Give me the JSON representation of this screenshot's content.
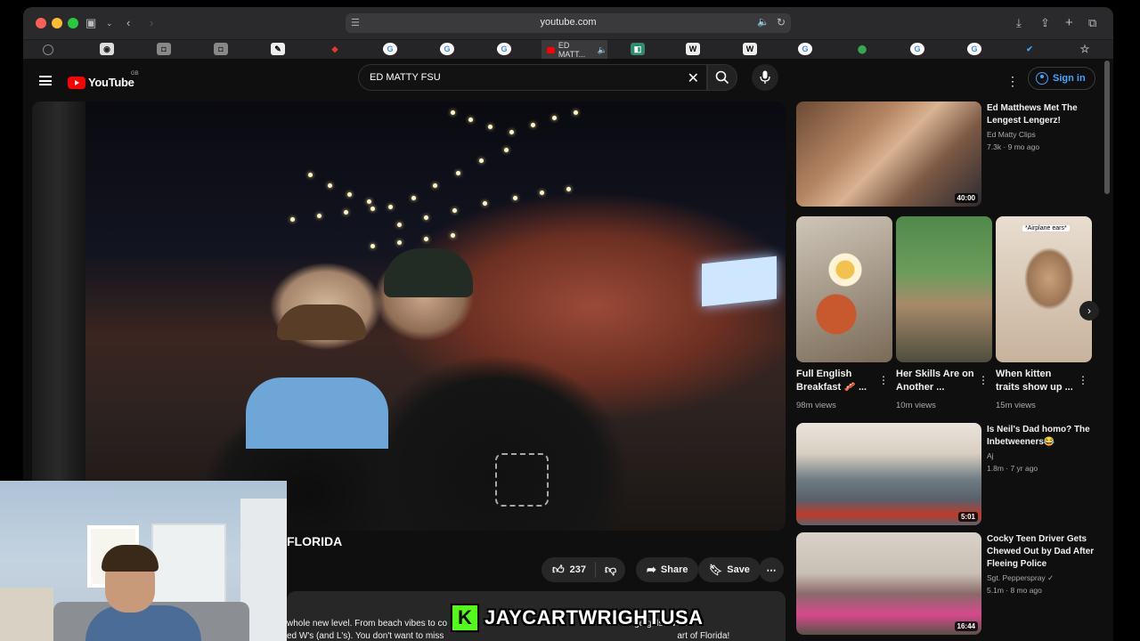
{
  "browser": {
    "url": "youtube.com",
    "active_tab_label": "ED MATT..."
  },
  "header": {
    "logo_text": "YouTube",
    "logo_region": "GB",
    "search_value": "ED MATTY FSU",
    "sign_in": "Sign in"
  },
  "video": {
    "title_visible": "FLORIDA",
    "likes": "237",
    "share_label": "Share",
    "save_label": "Save",
    "description_line1": "whole new level. From beach vibes to co",
    "description_line1_end": "ge girls. Watch",
    "description_line2": "ed W's (and L's). You don't want to miss",
    "description_line2_end": "art of Florida!"
  },
  "sidebar": {
    "videos": [
      {
        "title": "Ed Matthews Met The Lengest Lengerz!",
        "channel": "Ed Matty Clips",
        "meta": "7.3k · 9 mo ago",
        "duration": "40:00"
      },
      {
        "title": "Is Neil's Dad homo? The Inbetweeners😂",
        "channel": "Aj",
        "meta": "1.8m · 7 yr ago",
        "duration": "5:01"
      },
      {
        "title": "Cocky Teen Driver Gets Chewed Out by Dad After Fleeing Police",
        "channel": "Sgt. Pepperspray ✓",
        "meta": "5.1m · 8 mo ago",
        "duration": "16:44"
      }
    ],
    "shorts": [
      {
        "title": "Full English Breakfast 🥓 ...",
        "views": "98m views"
      },
      {
        "title": "Her Skills Are on Another ...",
        "views": "10m views"
      },
      {
        "title": "When kitten traits show up ...",
        "views": "15m views",
        "overlay": "*Airplane ears*"
      }
    ]
  },
  "watermark": {
    "letter": "K",
    "name": "JAYCARTWRIGHTUSA"
  },
  "colors": {
    "accent_blue": "#3ea6ff",
    "youtube_red": "#ff0000",
    "kick_green": "#53fc18"
  }
}
